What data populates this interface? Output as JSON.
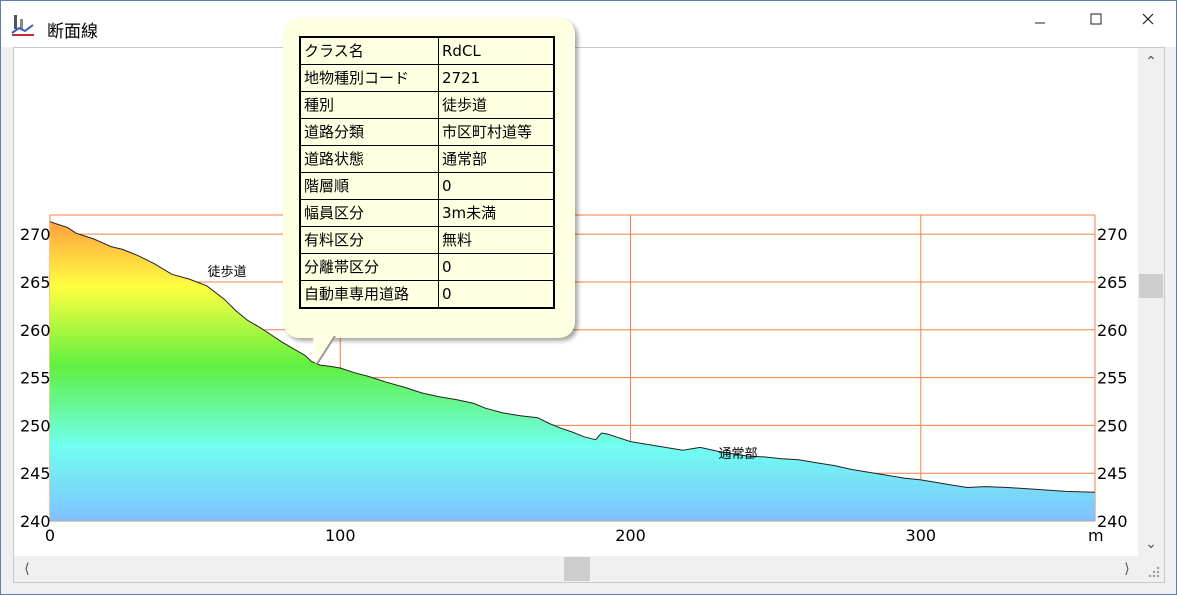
{
  "window": {
    "title": "断面線",
    "icon": "profile-app-icon"
  },
  "controls": {
    "minimize": "minimize-icon",
    "maximize": "maximize-icon",
    "close": "close-icon"
  },
  "attributes": [
    {
      "key": "クラス名",
      "value": "RdCL"
    },
    {
      "key": "地物種別コード",
      "value": "2721"
    },
    {
      "key": "種別",
      "value": "徒歩道"
    },
    {
      "key": "道路分類",
      "value": "市区町村道等"
    },
    {
      "key": "道路状態",
      "value": "通常部"
    },
    {
      "key": "階層順",
      "value": "0"
    },
    {
      "key": "幅員区分",
      "value": "3m未満"
    },
    {
      "key": "有料区分",
      "value": "無料"
    },
    {
      "key": "分離帯区分",
      "value": "0"
    },
    {
      "key": "自動車専用道路",
      "value": "0"
    }
  ],
  "chart_data": {
    "type": "area",
    "x_unit": "m",
    "x_ticks": [
      "0",
      "100",
      "200",
      "300"
    ],
    "y_ticks": [
      "240",
      "245",
      "250",
      "255",
      "260",
      "265",
      "270"
    ],
    "xlim": [
      0,
      360
    ],
    "ylim": [
      240,
      272
    ],
    "grid": true,
    "grid_color": "#f08040",
    "gradient": [
      "#ffa040",
      "#ffff40",
      "#60f040",
      "#70fff0",
      "#80c0ff"
    ],
    "x": [
      0,
      1,
      3,
      6,
      9,
      12,
      15,
      18,
      21,
      25,
      30,
      36,
      42,
      48,
      54,
      60,
      64,
      68,
      72,
      76,
      80,
      84,
      88,
      90,
      93,
      96,
      100,
      105,
      110,
      116,
      122,
      128,
      134,
      140,
      146,
      150,
      156,
      162,
      168,
      172,
      176,
      180,
      184,
      188,
      190,
      192,
      196,
      200,
      206,
      212,
      218,
      224,
      230,
      236,
      240,
      246,
      252,
      258,
      264,
      270,
      276,
      282,
      288,
      294,
      300,
      306,
      310,
      316,
      322,
      330,
      340,
      350,
      360
    ],
    "y": [
      271.3,
      271.2,
      271.0,
      270.7,
      270.1,
      269.8,
      269.5,
      269.1,
      268.7,
      268.4,
      267.8,
      266.9,
      265.8,
      265.3,
      264.6,
      263.2,
      262.0,
      261.0,
      260.3,
      259.5,
      258.7,
      258.0,
      257.3,
      256.7,
      256.3,
      256.2,
      256.0,
      255.5,
      255.1,
      254.5,
      254.0,
      253.4,
      253.0,
      252.7,
      252.3,
      251.8,
      251.3,
      251.0,
      250.8,
      250.2,
      249.7,
      249.3,
      248.8,
      248.5,
      249.2,
      249.1,
      248.7,
      248.3,
      248.0,
      247.7,
      247.4,
      247.7,
      247.3,
      247.0,
      246.8,
      246.7,
      246.5,
      246.4,
      246.1,
      245.8,
      245.4,
      245.1,
      244.8,
      244.5,
      244.3,
      244.0,
      243.8,
      243.5,
      243.6,
      243.5,
      243.3,
      243.1,
      243.0
    ],
    "annotations": [
      {
        "text": "徒歩道",
        "x": 61,
        "y": 265.6
      },
      {
        "text": "通常部",
        "x": 237,
        "y": 246.6
      }
    ]
  }
}
